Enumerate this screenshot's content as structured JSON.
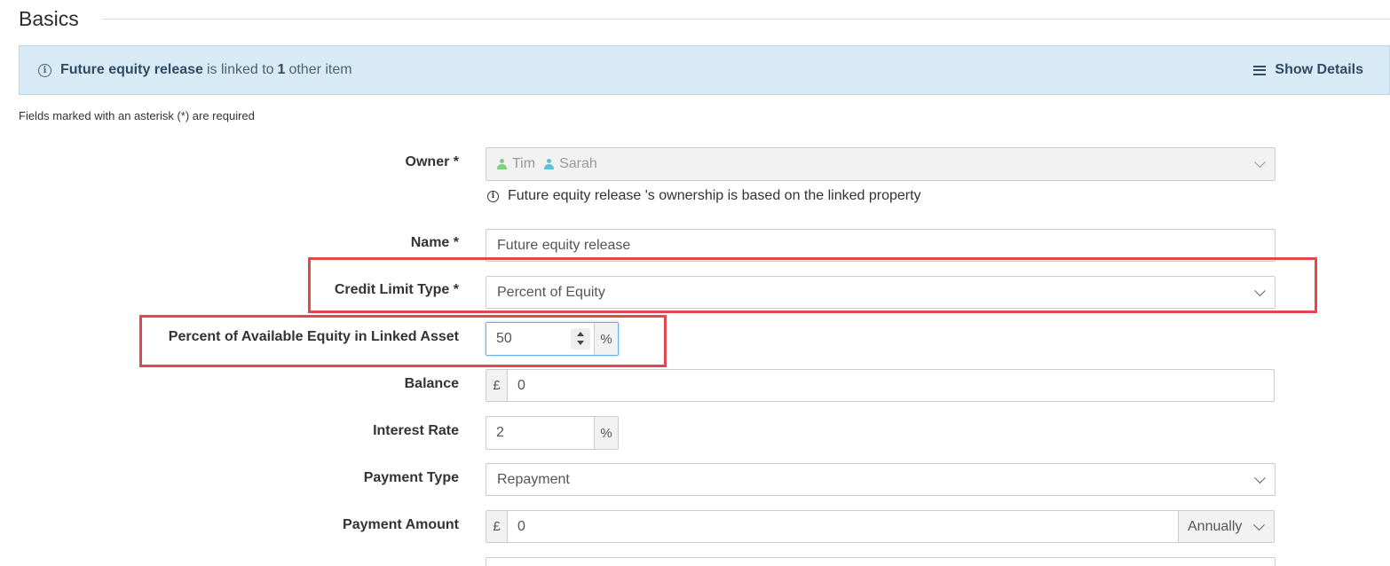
{
  "section": {
    "title": "Basics"
  },
  "banner": {
    "item_name": "Future equity release",
    "text_mid": "is linked to",
    "count": "1",
    "text_end": "other item",
    "show_details_label": "Show Details"
  },
  "required_note": "Fields marked with an asterisk (*) are required",
  "form": {
    "owner": {
      "label": "Owner *",
      "owners": [
        "Tim",
        "Sarah"
      ],
      "note": "Future equity release 's ownership is based on the linked property"
    },
    "name": {
      "label": "Name *",
      "value": "Future equity release"
    },
    "credit_limit_type": {
      "label": "Credit Limit Type *",
      "value": "Percent of Equity"
    },
    "percent_equity": {
      "label": "Percent of Available Equity in Linked Asset",
      "value": "50",
      "unit": "%"
    },
    "balance": {
      "label": "Balance",
      "currency": "£",
      "value": "0"
    },
    "interest_rate": {
      "label": "Interest Rate",
      "value": "2",
      "unit": "%"
    },
    "payment_type": {
      "label": "Payment Type",
      "value": "Repayment"
    },
    "payment_amount": {
      "label": "Payment Amount",
      "currency": "£",
      "value": "0",
      "frequency": "Annually"
    }
  },
  "colors": {
    "banner_bg": "#d9eaf7",
    "highlight": "#e2474c",
    "owner_tim": "#7ed07a",
    "owner_sarah": "#59c3d9"
  }
}
